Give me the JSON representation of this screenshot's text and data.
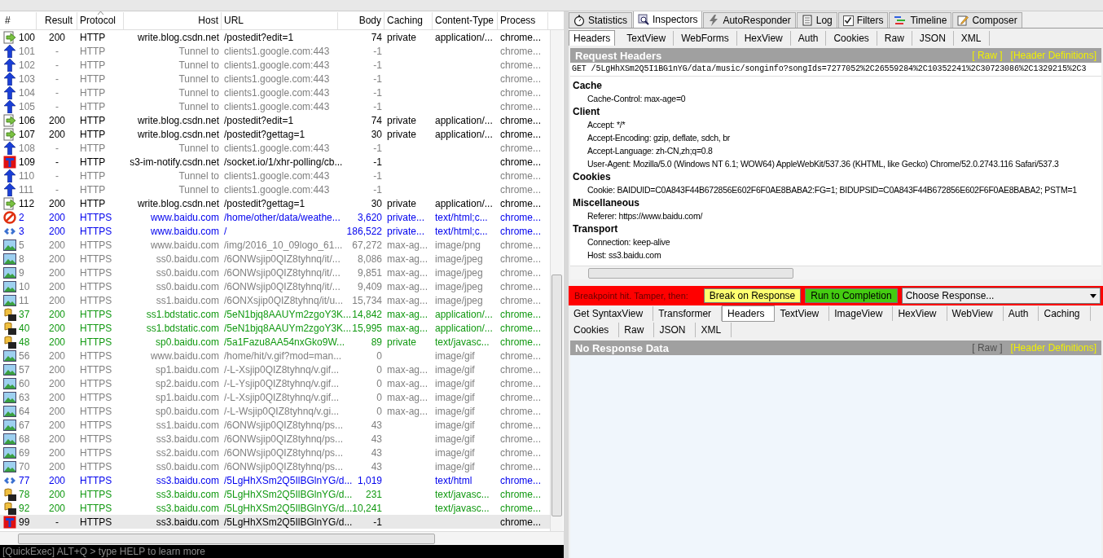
{
  "columns": [
    "#",
    "Result",
    "Protocol",
    "Host",
    "URL",
    "Body",
    "Caching",
    "Content-Type",
    "Process"
  ],
  "sessions": [
    {
      "kind": "response",
      "id": "100",
      "result": "200",
      "protocol": "HTTP",
      "host": "write.blog.csdn.net",
      "url": "/postedit?edit=1",
      "body": "74",
      "caching": "private",
      "content_type": "application/...",
      "process": "chrome...",
      "color": "#000000",
      "selected": false
    },
    {
      "kind": "tunnel",
      "id": "101",
      "result": "-",
      "protocol": "HTTP",
      "host": "Tunnel to",
      "url": "clients1.google.com:443",
      "body": "-1",
      "process": "chrome...",
      "color": "#808080",
      "selected": false
    },
    {
      "kind": "tunnel",
      "id": "102",
      "result": "-",
      "protocol": "HTTP",
      "host": "Tunnel to",
      "url": "clients1.google.com:443",
      "body": "-1",
      "process": "chrome...",
      "color": "#808080",
      "selected": false
    },
    {
      "kind": "tunnel",
      "id": "103",
      "result": "-",
      "protocol": "HTTP",
      "host": "Tunnel to",
      "url": "clients1.google.com:443",
      "body": "-1",
      "process": "chrome...",
      "color": "#808080",
      "selected": false
    },
    {
      "kind": "tunnel",
      "id": "104",
      "result": "-",
      "protocol": "HTTP",
      "host": "Tunnel to",
      "url": "clients1.google.com:443",
      "body": "-1",
      "process": "chrome...",
      "color": "#808080",
      "selected": false
    },
    {
      "kind": "tunnel",
      "id": "105",
      "result": "-",
      "protocol": "HTTP",
      "host": "Tunnel to",
      "url": "clients1.google.com:443",
      "body": "-1",
      "process": "chrome...",
      "color": "#808080",
      "selected": false
    },
    {
      "kind": "response",
      "id": "106",
      "result": "200",
      "protocol": "HTTP",
      "host": "write.blog.csdn.net",
      "url": "/postedit?edit=1",
      "body": "74",
      "caching": "private",
      "content_type": "application/...",
      "process": "chrome...",
      "color": "#000000",
      "selected": false
    },
    {
      "kind": "response",
      "id": "107",
      "result": "200",
      "protocol": "HTTP",
      "host": "write.blog.csdn.net",
      "url": "/postedit?gettag=1",
      "body": "30",
      "caching": "private",
      "content_type": "application/...",
      "process": "chrome...",
      "color": "#000000",
      "selected": false
    },
    {
      "kind": "tunnel",
      "id": "108",
      "result": "-",
      "protocol": "HTTP",
      "host": "Tunnel to",
      "url": "clients1.google.com:443",
      "body": "-1",
      "process": "chrome...",
      "color": "#808080",
      "selected": false
    },
    {
      "kind": "breakpoint",
      "id": "109",
      "result": "-",
      "protocol": "HTTP",
      "host": "s3-im-notify.csdn.net",
      "url": "/socket.io/1/xhr-polling/cb...",
      "body": "-1",
      "process": "chrome...",
      "color": "#000000",
      "selected": false
    },
    {
      "kind": "tunnel",
      "id": "110",
      "result": "-",
      "protocol": "HTTP",
      "host": "Tunnel to",
      "url": "clients1.google.com:443",
      "body": "-1",
      "process": "chrome...",
      "color": "#808080",
      "selected": false
    },
    {
      "kind": "tunnel",
      "id": "111",
      "result": "-",
      "protocol": "HTTP",
      "host": "Tunnel to",
      "url": "clients1.google.com:443",
      "body": "-1",
      "process": "chrome...",
      "color": "#808080",
      "selected": false
    },
    {
      "kind": "response",
      "id": "112",
      "result": "200",
      "protocol": "HTTP",
      "host": "write.blog.csdn.net",
      "url": "/postedit?gettag=1",
      "body": "30",
      "caching": "private",
      "content_type": "application/...",
      "process": "chrome...",
      "color": "#000000",
      "selected": false
    },
    {
      "kind": "blocked",
      "id": "2",
      "result": "200",
      "protocol": "HTTPS",
      "host": "www.baidu.com",
      "url": "/home/other/data/weathe...",
      "body": "3,620",
      "caching": "private...",
      "content_type": "text/html;c...",
      "process": "chrome...",
      "color": "#0000ee",
      "selected": false
    },
    {
      "kind": "html",
      "id": "3",
      "result": "200",
      "protocol": "HTTPS",
      "host": "www.baidu.com",
      "url": "/",
      "body": "186,522",
      "caching": "private...",
      "content_type": "text/html;c...",
      "process": "chrome...",
      "color": "#0000ee",
      "selected": false
    },
    {
      "kind": "image",
      "id": "5",
      "result": "200",
      "protocol": "HTTPS",
      "host": "www.baidu.com",
      "url": "/img/2016_10_09logo_61...",
      "body": "67,272",
      "caching": "max-ag...",
      "content_type": "image/png",
      "process": "chrome...",
      "color": "#808080",
      "selected": false
    },
    {
      "kind": "image",
      "id": "8",
      "result": "200",
      "protocol": "HTTPS",
      "host": "ss0.baidu.com",
      "url": "/6ONWsjip0QIZ8tyhnq/it/...",
      "body": "8,086",
      "caching": "max-ag...",
      "content_type": "image/jpeg",
      "process": "chrome...",
      "color": "#808080",
      "selected": false
    },
    {
      "kind": "image",
      "id": "9",
      "result": "200",
      "protocol": "HTTPS",
      "host": "ss0.baidu.com",
      "url": "/6ONWsjip0QIZ8tyhnq/it/...",
      "body": "9,851",
      "caching": "max-ag...",
      "content_type": "image/jpeg",
      "process": "chrome...",
      "color": "#808080",
      "selected": false
    },
    {
      "kind": "image",
      "id": "10",
      "result": "200",
      "protocol": "HTTPS",
      "host": "ss0.baidu.com",
      "url": "/6ONWsjip0QIZ8tyhnq/it/...",
      "body": "9,409",
      "caching": "max-ag...",
      "content_type": "image/jpeg",
      "process": "chrome...",
      "color": "#808080",
      "selected": false
    },
    {
      "kind": "image",
      "id": "11",
      "result": "200",
      "protocol": "HTTPS",
      "host": "ss1.baidu.com",
      "url": "/6ONXsjip0QIZ8tyhnq/it/u...",
      "body": "15,734",
      "caching": "max-ag...",
      "content_type": "image/jpeg",
      "process": "chrome...",
      "color": "#808080",
      "selected": false
    },
    {
      "kind": "script",
      "id": "37",
      "result": "200",
      "protocol": "HTTPS",
      "host": "ss1.bdstatic.com",
      "url": "/5eN1bjq8AAUYm2zgoY3K...",
      "body": "14,842",
      "caching": "max-ag...",
      "content_type": "application/...",
      "process": "chrome...",
      "color": "#119911",
      "selected": false
    },
    {
      "kind": "script",
      "id": "40",
      "result": "200",
      "protocol": "HTTPS",
      "host": "ss1.bdstatic.com",
      "url": "/5eN1bjq8AAUYm2zgoY3K...",
      "body": "15,995",
      "caching": "max-ag...",
      "content_type": "application/...",
      "process": "chrome...",
      "color": "#119911",
      "selected": false
    },
    {
      "kind": "script",
      "id": "48",
      "result": "200",
      "protocol": "HTTPS",
      "host": "sp0.baidu.com",
      "url": "/5a1Fazu8AA54nxGko9W...",
      "body": "89",
      "caching": "private",
      "content_type": "text/javasc...",
      "process": "chrome...",
      "color": "#119911",
      "selected": false
    },
    {
      "kind": "image",
      "id": "56",
      "result": "200",
      "protocol": "HTTPS",
      "host": "www.baidu.com",
      "url": "/home/hit/v.gif?mod=man...",
      "body": "0",
      "content_type": "image/gif",
      "process": "chrome...",
      "color": "#808080",
      "selected": false
    },
    {
      "kind": "image",
      "id": "57",
      "result": "200",
      "protocol": "HTTPS",
      "host": "sp1.baidu.com",
      "url": "/-L-Xsjip0QIZ8tyhnq/v.gif...",
      "body": "0",
      "caching": "max-ag...",
      "content_type": "image/gif",
      "process": "chrome...",
      "color": "#808080",
      "selected": false
    },
    {
      "kind": "image",
      "id": "60",
      "result": "200",
      "protocol": "HTTPS",
      "host": "sp2.baidu.com",
      "url": "/-L-Ysjip0QIZ8tyhnq/v.gif...",
      "body": "0",
      "caching": "max-ag...",
      "content_type": "image/gif",
      "process": "chrome...",
      "color": "#808080",
      "selected": false
    },
    {
      "kind": "image",
      "id": "63",
      "result": "200",
      "protocol": "HTTPS",
      "host": "sp1.baidu.com",
      "url": "/-L-Xsjip0QIZ8tyhnq/v.gif...",
      "body": "0",
      "caching": "max-ag...",
      "content_type": "image/gif",
      "process": "chrome...",
      "color": "#808080",
      "selected": false
    },
    {
      "kind": "image",
      "id": "64",
      "result": "200",
      "protocol": "HTTPS",
      "host": "sp0.baidu.com",
      "url": "/-L-Wsjip0QIZ8tyhnq/v.gi...",
      "body": "0",
      "caching": "max-ag...",
      "content_type": "image/gif",
      "process": "chrome...",
      "color": "#808080",
      "selected": false
    },
    {
      "kind": "image",
      "id": "67",
      "result": "200",
      "protocol": "HTTPS",
      "host": "ss1.baidu.com",
      "url": "/6ONWsjip0QIZ8tyhnq/ps...",
      "body": "43",
      "content_type": "image/gif",
      "process": "chrome...",
      "color": "#808080",
      "selected": false
    },
    {
      "kind": "image",
      "id": "68",
      "result": "200",
      "protocol": "HTTPS",
      "host": "ss3.baidu.com",
      "url": "/6ONWsjip0QIZ8tyhnq/ps...",
      "body": "43",
      "content_type": "image/gif",
      "process": "chrome...",
      "color": "#808080",
      "selected": false
    },
    {
      "kind": "image",
      "id": "69",
      "result": "200",
      "protocol": "HTTPS",
      "host": "ss2.baidu.com",
      "url": "/6ONWsjip0QIZ8tyhnq/ps...",
      "body": "43",
      "content_type": "image/gif",
      "process": "chrome...",
      "color": "#808080",
      "selected": false
    },
    {
      "kind": "image",
      "id": "70",
      "result": "200",
      "protocol": "HTTPS",
      "host": "ss0.baidu.com",
      "url": "/6ONWsjip0QIZ8tyhnq/ps...",
      "body": "43",
      "content_type": "image/gif",
      "process": "chrome...",
      "color": "#808080",
      "selected": false
    },
    {
      "kind": "html",
      "id": "77",
      "result": "200",
      "protocol": "HTTPS",
      "host": "ss3.baidu.com",
      "url": "/5LgHhXSm2Q5IlBGlnYG/d...",
      "body": "1,019",
      "content_type": "text/html",
      "process": "chrome...",
      "color": "#0000ee",
      "selected": false
    },
    {
      "kind": "script",
      "id": "78",
      "result": "200",
      "protocol": "HTTPS",
      "host": "ss3.baidu.com",
      "url": "/5LgHhXSm2Q5IlBGlnYG/d...",
      "body": "231",
      "content_type": "text/javasc...",
      "process": "chrome...",
      "color": "#119911",
      "selected": false
    },
    {
      "kind": "script",
      "id": "92",
      "result": "200",
      "protocol": "HTTPS",
      "host": "ss3.baidu.com",
      "url": "/5LgHhXSm2Q5IlBGlnYG/d...",
      "body": "10,241",
      "content_type": "text/javasc...",
      "process": "chrome...",
      "color": "#119911",
      "selected": false
    },
    {
      "kind": "breakpoint",
      "id": "99",
      "result": "-",
      "protocol": "HTTPS",
      "host": "ss3.baidu.com",
      "url": "/5LgHhXSm2Q5IlBGlnYG/d...",
      "body": "-1",
      "process": "chrome...",
      "color": "#000000",
      "selected": true
    }
  ],
  "quickexec": {
    "placeholder": "[QuickExec] ALT+Q > type HELP to learn more"
  },
  "inspector_tabs": [
    {
      "kind": "stats",
      "label": "Statistics",
      "selected": false
    },
    {
      "kind": "inspect",
      "label": "Inspectors",
      "selected": true
    },
    {
      "kind": "bolt",
      "label": "AutoResponder",
      "selected": false
    },
    {
      "kind": "log",
      "label": "Log",
      "selected": false
    },
    {
      "kind": "checkbox",
      "label": "Filters",
      "selected": false,
      "checked": true
    },
    {
      "kind": "timeline",
      "label": "Timeline",
      "selected": false
    },
    {
      "kind": "compose",
      "label": "Composer",
      "selected": false
    }
  ],
  "request_tabs": [
    {
      "label": "Headers",
      "selected": true
    },
    {
      "label": "TextView",
      "selected": false
    },
    {
      "label": "WebForms",
      "selected": false
    },
    {
      "label": "HexView",
      "selected": false
    },
    {
      "label": "Auth",
      "selected": false
    },
    {
      "label": "Cookies",
      "selected": false
    },
    {
      "label": "Raw",
      "selected": false
    },
    {
      "label": "JSON",
      "selected": false
    },
    {
      "label": "XML",
      "selected": false
    }
  ],
  "request_headers": {
    "title": "Request Headers",
    "links": [
      {
        "label": "[ Raw ]",
        "disabled": false
      },
      {
        "label": "[Header Definitions]",
        "disabled": false
      }
    ],
    "request_line": "GET /5LgHhXSm2Q5I1BG1nYG/data/music/songinfo?songIds=7277052%2C26559284%2C10352241%2C30723086%2C1329215%2C3",
    "groups": [
      {
        "name": "Cache",
        "items": [
          "Cache-Control: max-age=0"
        ]
      },
      {
        "name": "Client",
        "items": [
          "Accept: */*",
          "Accept-Encoding: gzip, deflate, sdch, br",
          "Accept-Language: zh-CN,zh;q=0.8",
          "User-Agent: Mozilla/5.0 (Windows NT 6.1; WOW64) AppleWebKit/537.36 (KHTML, like Gecko) Chrome/52.0.2743.116 Safari/537.3"
        ]
      },
      {
        "name": "Cookies",
        "items": [
          "Cookie: BAIDUID=C0A843F44B672856E602F6F0AE8BABA2:FG=1; BIDUPSID=C0A843F44B672856E602F6F0AE8BABA2; PSTM=1"
        ]
      },
      {
        "name": "Miscellaneous",
        "items": [
          "Referer: https://www.baidu.com/"
        ]
      },
      {
        "name": "Transport",
        "items": [
          "Connection: keep-alive",
          "Host: ss3.baidu.com"
        ]
      }
    ]
  },
  "breakpoint_bar": {
    "label": "Breakpoint hit. Tamper, then:",
    "buttons": [
      {
        "kind": "break",
        "label": "Break on Response"
      },
      {
        "kind": "run",
        "label": "Run to Completion"
      }
    ],
    "dropdown": {
      "value": "Choose Response..."
    }
  },
  "response_tabs": [
    [
      {
        "label": "Get SyntaxView",
        "selected": false
      },
      {
        "label": "Transformer",
        "selected": false
      },
      {
        "label": "Headers",
        "selected": true
      },
      {
        "label": "TextView",
        "selected": false
      },
      {
        "label": "ImageView",
        "selected": false
      },
      {
        "label": "HexView",
        "selected": false
      },
      {
        "label": "WebView",
        "selected": false
      },
      {
        "label": "Auth",
        "selected": false
      },
      {
        "label": "Caching",
        "selected": false
      }
    ],
    [
      {
        "label": "Cookies",
        "selected": false
      },
      {
        "label": "Raw",
        "selected": false
      },
      {
        "label": "JSON",
        "selected": false
      },
      {
        "label": "XML",
        "selected": false
      }
    ]
  ],
  "response_headers": {
    "title": "No Response Data",
    "links": [
      {
        "label": "[ Raw ]",
        "disabled": true
      },
      {
        "label": "[Header Definitions]",
        "disabled": false
      }
    ]
  }
}
